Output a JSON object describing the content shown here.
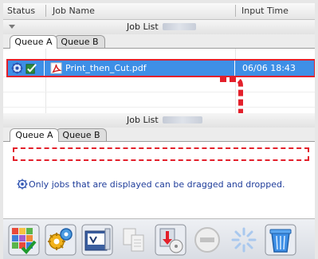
{
  "columns": {
    "status": "Status",
    "job_name": "Job Name",
    "input_time": "Input Time"
  },
  "upper_panel": {
    "title": "Job List",
    "tabs": [
      "Queue A",
      "Queue B"
    ],
    "active_tab": "Queue A",
    "rows": [
      {
        "name": "Print_then_Cut.pdf",
        "input_time": "06/06 18:43",
        "selected": true
      }
    ]
  },
  "lower_panel": {
    "title": "Job List",
    "tabs": [
      "Queue A",
      "Queue B"
    ],
    "active_tab": "Queue A"
  },
  "message": "Only jobs that are displayed can be dragged and dropped.",
  "toolbar": {
    "buttons": [
      {
        "icon": "job-grid-icon",
        "enabled": true
      },
      {
        "icon": "gear-settings-icon",
        "enabled": true
      },
      {
        "icon": "printer-settings-icon",
        "enabled": true
      },
      {
        "icon": "copy-document-icon",
        "enabled": false
      },
      {
        "icon": "output-to-disc-icon",
        "enabled": true
      },
      {
        "icon": "minus-icon",
        "enabled": false
      },
      {
        "icon": "spinner-icon",
        "enabled": false
      },
      {
        "icon": "trash-icon",
        "enabled": true
      }
    ]
  },
  "colors": {
    "selection": "#3e8fe6",
    "highlight": "#e3202b",
    "message_text": "#1e3c9a"
  }
}
